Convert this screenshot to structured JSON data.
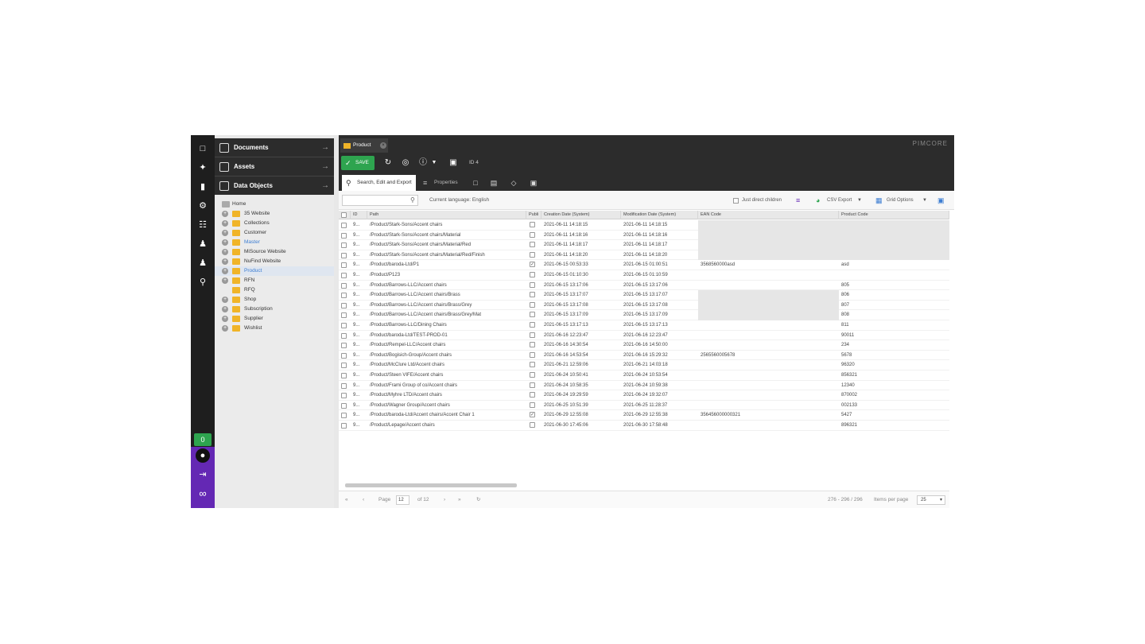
{
  "sidebar": {
    "sections": [
      {
        "label": "Documents"
      },
      {
        "label": "Assets"
      },
      {
        "label": "Data Objects"
      }
    ],
    "tree": [
      {
        "label": "Home"
      },
      {
        "label": "35 Website"
      },
      {
        "label": "Collections"
      },
      {
        "label": "Customer"
      },
      {
        "label": "Master"
      },
      {
        "label": "MiSource Website"
      },
      {
        "label": "NuFind Website"
      },
      {
        "label": "Product"
      },
      {
        "label": "RFN"
      },
      {
        "label": "RFQ"
      },
      {
        "label": "Shop"
      },
      {
        "label": "Subscription"
      },
      {
        "label": "Supplier"
      },
      {
        "label": "Wishlist"
      }
    ],
    "notification_count": "0"
  },
  "header": {
    "tab_label": "Product",
    "brand": "PIMCORE"
  },
  "toolbar": {
    "save_label": "SAVE",
    "id_label": "ID 4"
  },
  "subtabs": {
    "search_label": "Search, Edit and Export",
    "properties_label": "Properties"
  },
  "filter": {
    "search_placeholder": "",
    "language_label": "Current language: English",
    "direct_children_label": "Just direct children",
    "csv_export_label": "CSV Export",
    "grid_options_label": "Grid Options"
  },
  "grid": {
    "columns": [
      "ID",
      "Path",
      "Publi",
      "Creation Date (System)",
      "Modification Date (System)",
      "EAN Code",
      "Product Code"
    ],
    "rows": [
      {
        "id": "9...",
        "path": "/Product/Stark-Sons/Accent chairs",
        "published": "",
        "created": "2021-06-11 14:18:15",
        "modified": "2021-06-11 14:18:15",
        "ean": "",
        "code": ""
      },
      {
        "id": "9...",
        "path": "/Product/Stark-Sons/Accent chairs/Material",
        "published": "",
        "created": "2021-06-11 14:18:16",
        "modified": "2021-06-11 14:18:16",
        "ean": "",
        "code": ""
      },
      {
        "id": "9...",
        "path": "/Product/Stark-Sons/Accent chairs/Material/Red",
        "published": "",
        "created": "2021-06-11 14:18:17",
        "modified": "2021-06-11 14:18:17",
        "ean": "",
        "code": ""
      },
      {
        "id": "9...",
        "path": "/Product/Stark-Sons/Accent chairs/Material/Red/Finish",
        "published": "",
        "created": "2021-06-11 14:18:20",
        "modified": "2021-06-11 14:18:20",
        "ean": "",
        "code": ""
      },
      {
        "id": "9...",
        "path": "/Product/baroda-Ltd/P1",
        "published": "✓",
        "created": "2021-06-15 00:53:33",
        "modified": "2021-06-15 01:00:51",
        "ean": "3568560000asd",
        "code": "asd"
      },
      {
        "id": "9...",
        "path": "/Product/P123",
        "published": "",
        "created": "2021-06-15 01:10:30",
        "modified": "2021-06-15 01:10:59",
        "ean": "",
        "code": ""
      },
      {
        "id": "9...",
        "path": "/Product/Barrows-LLC/Accent chairs",
        "published": "",
        "created": "2021-06-15 13:17:06",
        "modified": "2021-06-15 13:17:06",
        "ean": "",
        "code": "805"
      },
      {
        "id": "9...",
        "path": "/Product/Barrows-LLC/Accent chairs/Brass",
        "published": "",
        "created": "2021-06-15 13:17:07",
        "modified": "2021-06-15 13:17:07",
        "ean": "",
        "code": "806"
      },
      {
        "id": "9...",
        "path": "/Product/Barrows-LLC/Accent chairs/Brass/Grey",
        "published": "",
        "created": "2021-06-15 13:17:08",
        "modified": "2021-06-15 13:17:08",
        "ean": "",
        "code": "807"
      },
      {
        "id": "9...",
        "path": "/Product/Barrows-LLC/Accent chairs/Brass/Grey/Mat",
        "published": "",
        "created": "2021-06-15 13:17:09",
        "modified": "2021-06-15 13:17:09",
        "ean": "",
        "code": "808"
      },
      {
        "id": "9...",
        "path": "/Product/Barrows-LLC/Dining Chairs",
        "published": "",
        "created": "2021-06-15 13:17:13",
        "modified": "2021-06-15 13:17:13",
        "ean": "",
        "code": "811"
      },
      {
        "id": "9...",
        "path": "/Product/baroda-Ltd/TEST-PROD-01",
        "published": "",
        "created": "2021-06-16 12:23:47",
        "modified": "2021-06-16 12:23:47",
        "ean": "",
        "code": "90011"
      },
      {
        "id": "9...",
        "path": "/Product/Rempel-LLC/Accent chairs",
        "published": "",
        "created": "2021-06-16 14:30:54",
        "modified": "2021-06-16 14:50:00",
        "ean": "",
        "code": "234"
      },
      {
        "id": "9...",
        "path": "/Product/Bogisich-Group/Accent chairs",
        "published": "",
        "created": "2021-06-16 14:53:54",
        "modified": "2021-06-16 15:29:32",
        "ean": "2565560005678",
        "code": "5678"
      },
      {
        "id": "9...",
        "path": "/Product/McClure Ltd/Accent chairs",
        "published": "",
        "created": "2021-06-21 12:59:06",
        "modified": "2021-06-21 14:03:18",
        "ean": "",
        "code": "96320"
      },
      {
        "id": "9...",
        "path": "/Product/Steen VIFE/Accent chairs",
        "published": "",
        "created": "2021-06-24 10:50:41",
        "modified": "2021-06-24 10:53:54",
        "ean": "",
        "code": "856321"
      },
      {
        "id": "9...",
        "path": "/Product/Frami Group of co/Accent chairs",
        "published": "",
        "created": "2021-06-24 10:58:35",
        "modified": "2021-06-24 10:59:38",
        "ean": "",
        "code": "12340"
      },
      {
        "id": "9...",
        "path": "/Product/Myhre LTD/Accent chairs",
        "published": "",
        "created": "2021-06-24 19:29:59",
        "modified": "2021-06-24 19:32:07",
        "ean": "",
        "code": "870002"
      },
      {
        "id": "9...",
        "path": "/Product/Wagner Group/Accent chairs",
        "published": "",
        "created": "2021-06-25 10:51:39",
        "modified": "2021-06-25 11:28:37",
        "ean": "",
        "code": "002133"
      },
      {
        "id": "9...",
        "path": "/Product/baroda-Ltd/Accent chairs/Accent Chair 1",
        "published": "✓",
        "created": "2021-06-29 12:55:08",
        "modified": "2021-06-29 12:55:38",
        "ean": "356456000000321",
        "code": "5427"
      },
      {
        "id": "9...",
        "path": "/Product/Lepage/Accent chairs",
        "published": "",
        "created": "2021-06-30 17:45:06",
        "modified": "2021-06-30 17:58:48",
        "ean": "",
        "code": "896321"
      }
    ]
  },
  "pager": {
    "page_label": "Page",
    "current_page": "12",
    "of_label": "of 12",
    "range_label": "276 - 296 / 296",
    "items_per_page_label": "Items per page",
    "items_per_page": "25"
  }
}
